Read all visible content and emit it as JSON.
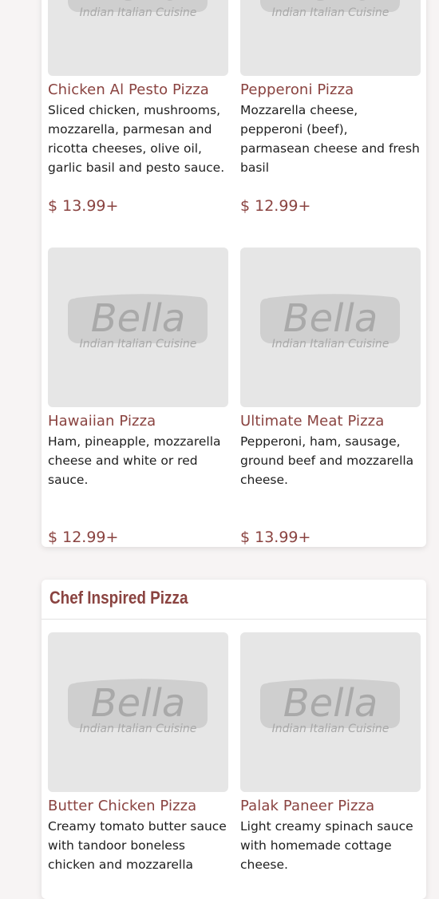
{
  "section_one": {
    "items": [
      {
        "name": "Chicken Al Pesto Pizza",
        "description": "Sliced chicken, mushrooms, mozzarella, parmesan and ricotta cheeses, olive oil, garlic basil and pesto sauce.",
        "price": "$ 13.99+"
      },
      {
        "name": "Pepperoni Pizza",
        "description": "Mozzarella cheese, pepperoni (beef), parmasean cheese and fresh basil",
        "price": "$ 12.99+"
      },
      {
        "name": "Hawaiian Pizza",
        "description": "Ham, pineapple, mozzarella cheese and white or red sauce.",
        "price": "$ 12.99+"
      },
      {
        "name": "Ultimate Meat Pizza",
        "description": "Pepperoni, ham, sausage, ground beef and mozzarella cheese.",
        "price": "$ 13.99+"
      }
    ]
  },
  "section_two": {
    "title": "Chef Inspired Pizza",
    "items": [
      {
        "name": "Butter Chicken Pizza",
        "description": "Creamy tomato butter sauce with tandoor boneless chicken and mozzarella"
      },
      {
        "name": "Palak Paneer Pizza",
        "description": "Light creamy spinach sauce with homemade cottage cheese."
      }
    ]
  },
  "placeholder_logo": {
    "wordmark": "Bella",
    "tagline": "Indian Italian Cuisine"
  },
  "colors": {
    "accent": "#8a4340",
    "text": "#1e1e1e",
    "image_placeholder": "#e6e6e6",
    "page_background": "#f7f4f4",
    "card_background": "#ffffff"
  }
}
